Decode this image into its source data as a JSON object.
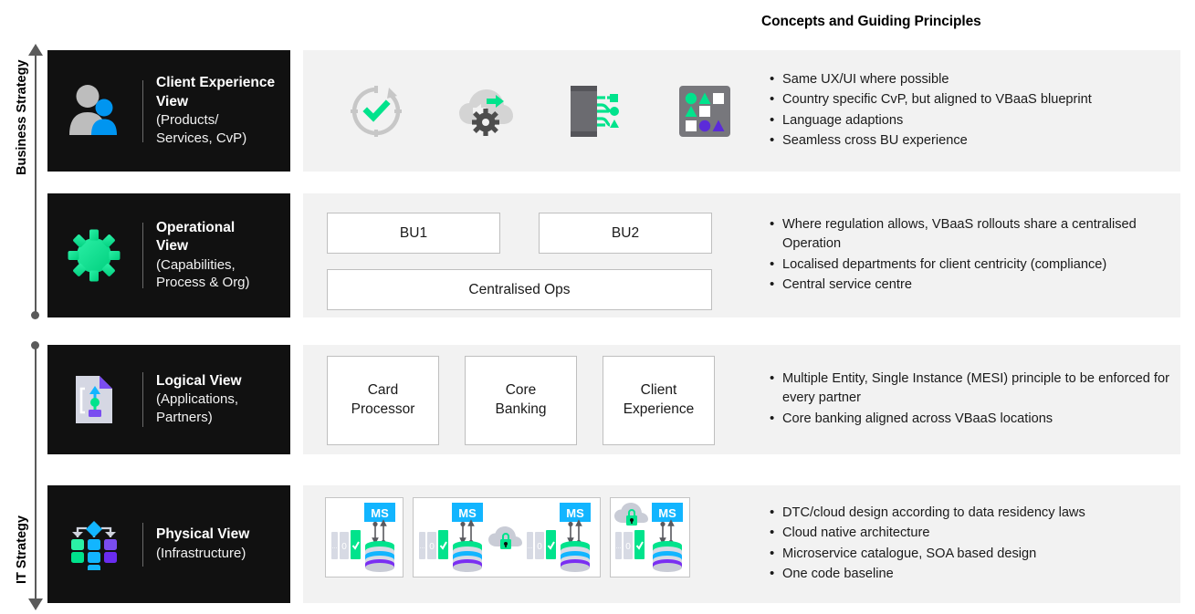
{
  "header": {
    "title": "Concepts and Guiding Principles"
  },
  "axis": {
    "business_label": "Business Strategy",
    "it_label": "IT Strategy",
    "arrow_up_icon": "arrow-up-icon",
    "arrow_down_icon": "arrow-down-icon",
    "dot_icon": "dot-marker-icon"
  },
  "colors": {
    "card_background": "#111111",
    "panel_background": "#f2f2f2",
    "accent_green": "#00e38c",
    "accent_blue": "#0095f0",
    "accent_cyan": "#12b5ff",
    "accent_purple": "#7a2ff2",
    "grey_icon": "#bdbdbd",
    "dark_grey_icon": "#6b6b70"
  },
  "rows": [
    {
      "id": "client-experience",
      "icon": "people-icon",
      "title": "Client Experience View",
      "title_line1": "Client Experience",
      "title_line2": "View",
      "subtitle_line1": "(Products/",
      "subtitle_line2": "Services, CvP)",
      "visual_icons": [
        "clock-check-icon",
        "cloud-sync-gear-icon",
        "mobile-integration-icon",
        "app-tiles-icon"
      ],
      "bullets": [
        "Same UX/UI where possible",
        "Country specific CvP, but aligned to VBaaS blueprint",
        "Language adaptions",
        "Seamless cross BU experience"
      ]
    },
    {
      "id": "operational",
      "icon": "gear-icon",
      "title": "Operational View",
      "title_line1": "Operational",
      "title_line2": "View",
      "subtitle_line1": "(Capabilities,",
      "subtitle_line2": "Process & Org)",
      "boxes_top": [
        "BU1",
        "BU2"
      ],
      "boxes_bottom": [
        "Centralised Ops"
      ],
      "bullets": [
        "Where regulation allows, VBaaS rollouts share a centralised Operation",
        "Localised departments for client centricity (compliance)",
        "Central service centre"
      ]
    },
    {
      "id": "logical",
      "icon": "document-shapes-icon",
      "title": "Logical View",
      "title_line1": "Logical View",
      "title_line2": "",
      "subtitle_line1": "(Applications,",
      "subtitle_line2": "Partners)",
      "boxes": [
        {
          "line1": "Card",
          "line2": "Processor"
        },
        {
          "line1": "Core",
          "line2": "Banking"
        },
        {
          "line1": "Client",
          "line2": "Experience"
        }
      ],
      "bullets": [
        "Multiple Entity, Single Instance (MESI) principle to be enforced for every partner",
        "Core banking aligned across VBaaS locations"
      ]
    },
    {
      "id": "physical",
      "icon": "network-nodes-icon",
      "title": "Physical View",
      "title_line1": "Physical View",
      "title_line2": "",
      "subtitle_line1": "(Infrastructure)",
      "subtitle_line2": "",
      "ms_label": "MS",
      "infra_icons": [
        "microservice-icon",
        "database-icon",
        "cloud-lock-icon",
        "server-stack-icon"
      ],
      "bullets": [
        "DTC/cloud design according to data residency laws",
        "Cloud native architecture",
        "Microservice catalogue, SOA based design",
        "One code baseline"
      ]
    }
  ]
}
